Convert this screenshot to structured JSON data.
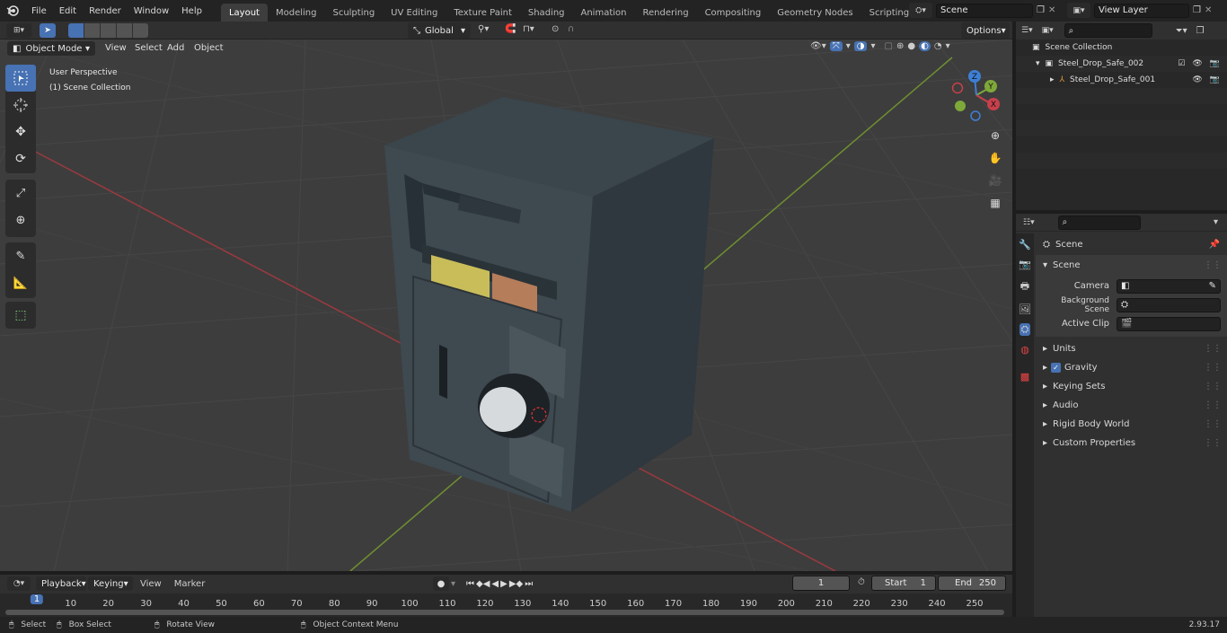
{
  "menus": [
    "File",
    "Edit",
    "Render",
    "Window",
    "Help"
  ],
  "workspaces": [
    "Layout",
    "Modeling",
    "Sculpting",
    "UV Editing",
    "Texture Paint",
    "Shading",
    "Animation",
    "Rendering",
    "Compositing",
    "Geometry Nodes",
    "Scripting"
  ],
  "scene_field": "Scene",
  "view_layer_field": "View Layer",
  "viewport_header": {
    "mode": "Object Mode",
    "menus": [
      "View",
      "Select",
      "Add",
      "Object"
    ],
    "transform": "Global",
    "options": "Options"
  },
  "viewport": {
    "title": "User Perspective",
    "collection": "(1) Scene Collection",
    "gizmo": {
      "x": "X",
      "y": "Y",
      "z": "Z"
    }
  },
  "outliner": {
    "root": "Scene Collection",
    "items": [
      "Steel_Drop_Safe_002",
      "Steel_Drop_Safe_001"
    ]
  },
  "properties": {
    "context": "Scene",
    "section": "Scene",
    "fields": [
      {
        "label": "Camera"
      },
      {
        "label": "Background Scene"
      },
      {
        "label": "Active Clip"
      }
    ],
    "panels": [
      "Units",
      "Gravity",
      "Keying Sets",
      "Audio",
      "Rigid Body World",
      "Custom Properties"
    ]
  },
  "timeline": {
    "menus": [
      "Playback",
      "Keying",
      "View",
      "Marker"
    ],
    "current_frame": "1",
    "start_label": "Start",
    "start": "1",
    "end_label": "End",
    "end": "250",
    "ticks": [
      "1",
      "10",
      "20",
      "30",
      "40",
      "50",
      "60",
      "70",
      "80",
      "90",
      "100",
      "110",
      "120",
      "130",
      "140",
      "150",
      "160",
      "170",
      "180",
      "190",
      "200",
      "210",
      "220",
      "230",
      "240",
      "250"
    ]
  },
  "status": {
    "select": "Select",
    "box_select": "Box Select",
    "rotate": "Rotate View",
    "context_menu": "Object Context Menu",
    "version": "2.93.17"
  },
  "colors": {
    "accent": "#4772b3",
    "x_axis": "#c7404b",
    "y_axis": "#7fa83a",
    "z_axis": "#3e7fd6"
  }
}
